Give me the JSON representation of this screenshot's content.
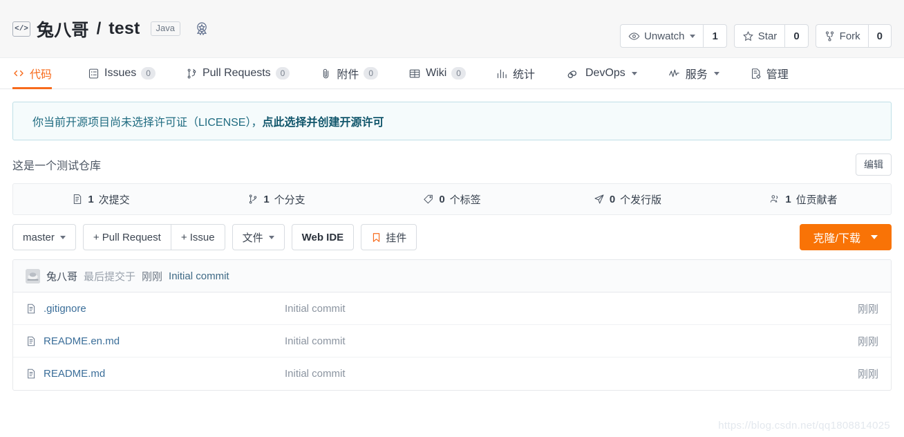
{
  "header": {
    "code_icon": "</>",
    "owner": "兔八哥",
    "separator": "/",
    "repo": "test",
    "language_tag": "Java",
    "medal_icon": "medal-star-icon",
    "actions": [
      {
        "icon": "eye-icon",
        "label": "Unwatch",
        "has_caret": true,
        "count": "1"
      },
      {
        "icon": "star-icon",
        "label": "Star",
        "has_caret": false,
        "count": "0"
      },
      {
        "icon": "fork-icon",
        "label": "Fork",
        "has_caret": false,
        "count": "0"
      }
    ]
  },
  "nav": {
    "tabs": [
      {
        "label": "代码",
        "icon": "code-icon",
        "count": null,
        "active": true,
        "caret": false
      },
      {
        "label": "Issues",
        "icon": "issue-list-icon",
        "count": "0",
        "active": false,
        "caret": false
      },
      {
        "label": "Pull Requests",
        "icon": "pull-request-icon",
        "count": "0",
        "active": false,
        "caret": false
      },
      {
        "label": "附件",
        "icon": "paperclip-icon",
        "count": "0",
        "active": false,
        "caret": false
      },
      {
        "label": "Wiki",
        "icon": "book-icon",
        "count": "0",
        "active": false,
        "caret": false
      },
      {
        "label": "统计",
        "icon": "chart-icon",
        "count": null,
        "active": false,
        "caret": false
      },
      {
        "label": "DevOps",
        "icon": "infinity-icon",
        "count": null,
        "active": false,
        "caret": true
      },
      {
        "label": "服务",
        "icon": "pulse-icon",
        "count": null,
        "active": false,
        "caret": true
      },
      {
        "label": "管理",
        "icon": "settings-doc-icon",
        "count": null,
        "active": false,
        "caret": false
      }
    ]
  },
  "license_banner": {
    "text": "你当前开源项目尚未选择许可证（LICENSE），",
    "link_text": "点此选择并创建开源许可"
  },
  "description": {
    "text": "这是一个测试仓库",
    "edit_label": "编辑"
  },
  "stats": [
    {
      "icon": "commit-icon",
      "count": "1",
      "label": "次提交"
    },
    {
      "icon": "branch-icon",
      "count": "1",
      "label": "个分支"
    },
    {
      "icon": "tag-icon",
      "count": "0",
      "label": "个标签"
    },
    {
      "icon": "release-icon",
      "count": "0",
      "label": "个发行版"
    },
    {
      "icon": "contributors-icon",
      "count": "1",
      "label": "位贡献者"
    }
  ],
  "toolbar": {
    "branch_label": "master",
    "pull_request_label": "+ Pull Request",
    "issue_label": "+ Issue",
    "files_label": "文件",
    "webide_label": "Web IDE",
    "widget_label": "挂件",
    "widget_icon": "bookmark-icon",
    "clone_label": "克隆/下载"
  },
  "commit_head": {
    "avatar": "user-avatar",
    "author": "兔八哥",
    "meta": "最后提交于",
    "time": "刚刚",
    "message": "Initial commit"
  },
  "files": [
    {
      "icon": "file-icon",
      "name": ".gitignore",
      "commit": "Initial commit",
      "time": "刚刚"
    },
    {
      "icon": "file-icon",
      "name": "README.en.md",
      "commit": "Initial commit",
      "time": "刚刚"
    },
    {
      "icon": "file-icon",
      "name": "README.md",
      "commit": "Initial commit",
      "time": "刚刚"
    }
  ],
  "watermark": {
    "text": "https://blog.csdn.net/qq1808814025"
  },
  "colors": {
    "accent_orange": "#f76b1c",
    "clone_orange": "#f97306",
    "link_blue": "#3b6e99",
    "banner_bg": "#f5fbfc",
    "banner_border": "#bfdfe6"
  }
}
